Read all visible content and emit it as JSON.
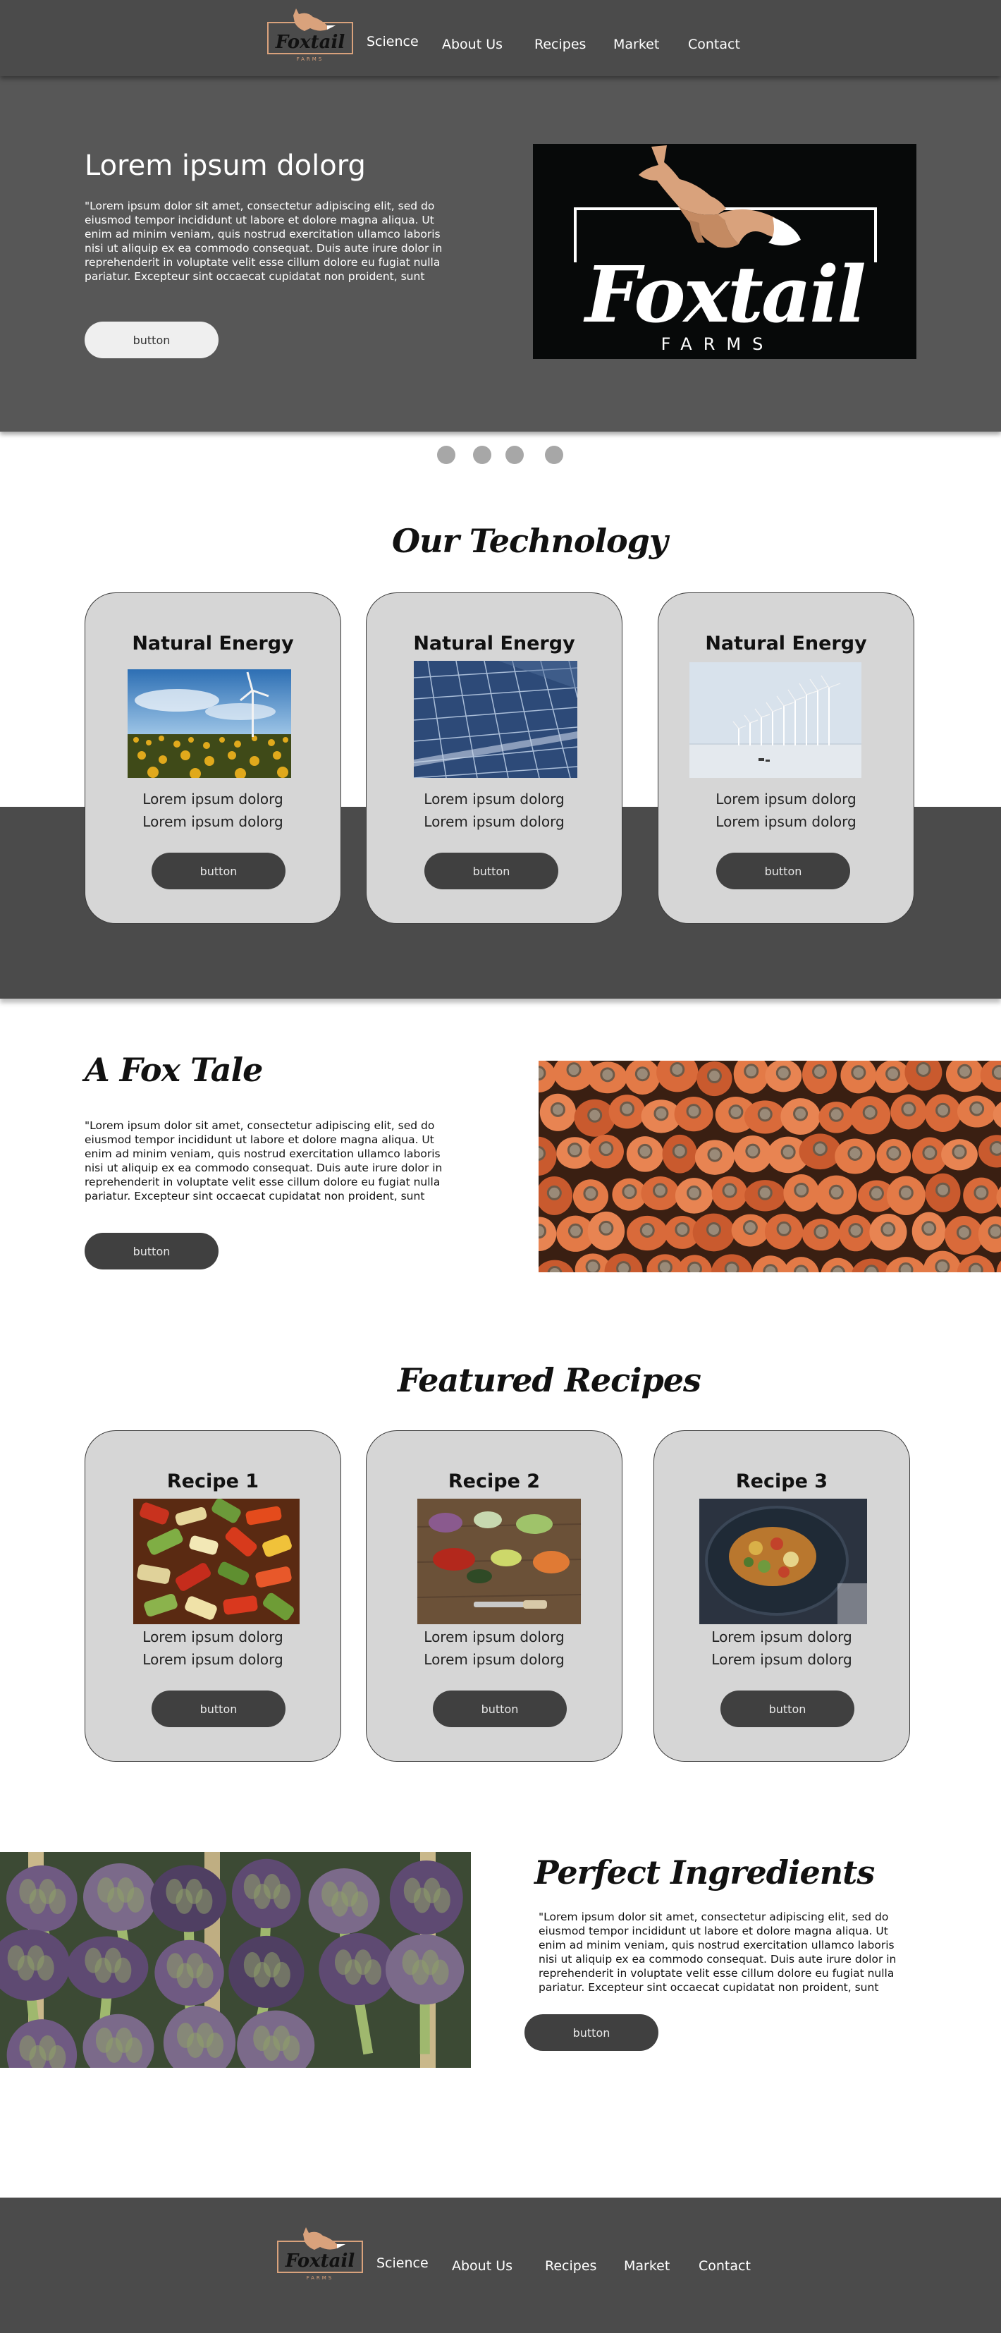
{
  "brand": {
    "name": "Foxtail",
    "tagline": "FARMS",
    "accent": "#d9a27c"
  },
  "nav": {
    "items": [
      {
        "label": "Science"
      },
      {
        "label": "About Us"
      },
      {
        "label": "Recipes"
      },
      {
        "label": "Market"
      },
      {
        "label": "Contact"
      }
    ]
  },
  "hero": {
    "title": "Lorem ipsum dolorg",
    "text": "\"Lorem ipsum dolor sit amet, consectetur adipiscing elit, sed do eiusmod tempor incididunt ut labore et dolore magna aliqua. Ut enim ad minim veniam, quis nostrud exercitation ullamco laboris nisi ut aliquip ex ea commodo consequat. Duis aute irure dolor in reprehenderit in voluptate velit esse cillum dolore eu fugiat nulla pariatur. Excepteur sint occaecat cupidatat non proident, sunt",
    "button": "button"
  },
  "carousel": {
    "slides": 4
  },
  "technology": {
    "heading": "Our Technology",
    "cards": [
      {
        "title": "Natural Energy",
        "line1": "Lorem ipsum dolorg",
        "line2": "Lorem ipsum dolorg",
        "button": "button",
        "image": "wind-turbine-sunflowers"
      },
      {
        "title": "Natural Energy",
        "line1": "Lorem ipsum dolorg",
        "line2": "Lorem ipsum dolorg",
        "button": "button",
        "image": "solar-panels"
      },
      {
        "title": "Natural Energy",
        "line1": "Lorem ipsum dolorg",
        "line2": "Lorem ipsum dolorg",
        "button": "button",
        "image": "offshore-wind-farm"
      }
    ]
  },
  "fox_tale": {
    "heading": "A Fox Tale",
    "text": "\"Lorem ipsum dolor sit amet, consectetur adipiscing elit, sed do eiusmod tempor incididunt ut labore et dolore magna aliqua. Ut enim ad minim veniam, quis nostrud exercitation ullamco laboris nisi ut aliquip ex ea commodo consequat. Duis aute irure dolor in reprehenderit in voluptate velit esse cillum dolore eu fugiat nulla pariatur. Excepteur sint occaecat cupidatat non proident, sunt",
    "button": "button",
    "image": "carrots"
  },
  "recipes": {
    "heading": "Featured Recipes",
    "cards": [
      {
        "title": "Recipe 1",
        "line1": "Lorem ipsum dolorg",
        "line2": "Lorem ipsum dolorg",
        "button": "button",
        "image": "roasted-vegetables"
      },
      {
        "title": "Recipe 2",
        "line1": "Lorem ipsum dolorg",
        "line2": "Lorem ipsum dolorg",
        "button": "button",
        "image": "chopped-vegetables"
      },
      {
        "title": "Recipe 3",
        "line1": "Lorem ipsum dolorg",
        "line2": "Lorem ipsum dolorg",
        "button": "button",
        "image": "plated-dish"
      }
    ]
  },
  "ingredients": {
    "heading": "Perfect Ingredients",
    "text": "\"Lorem ipsum dolor sit amet, consectetur adipiscing elit, sed do eiusmod tempor incididunt ut labore et dolore magna aliqua. Ut enim ad minim veniam, quis nostrud exercitation ullamco laboris nisi ut aliquip ex ea commodo consequat. Duis aute irure dolor in reprehenderit in voluptate velit esse cillum dolore eu fugiat nulla pariatur. Excepteur sint occaecat cupidatat non proident, sunt",
    "button": "button",
    "image": "artichokes"
  },
  "footer": {
    "items": [
      {
        "label": "Science"
      },
      {
        "label": "About Us"
      },
      {
        "label": "Recipes"
      },
      {
        "label": "Market"
      },
      {
        "label": "Contact"
      }
    ]
  }
}
